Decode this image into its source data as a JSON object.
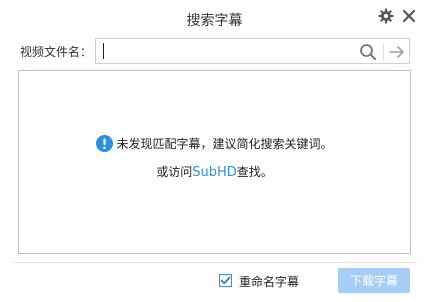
{
  "window": {
    "title": "搜索字幕"
  },
  "search": {
    "label": "视频文件名：",
    "value": "",
    "placeholder": ""
  },
  "results": {
    "message": "未发现匹配字幕，建议简化搜索关键词。",
    "visit_prefix": "或访问",
    "link_text": "SubHD",
    "visit_suffix": "查找。"
  },
  "footer": {
    "rename_label": "重命名字幕",
    "rename_checked": true,
    "download_label": "下载字幕"
  },
  "icons": {
    "settings": "gear-icon",
    "close": "close-icon",
    "search": "search-icon",
    "go": "arrow-right-icon",
    "info": "info-icon"
  },
  "colors": {
    "accent": "#2d8fe0",
    "button_disabled": "#a6cdf6",
    "border": "#b8c4d0"
  }
}
